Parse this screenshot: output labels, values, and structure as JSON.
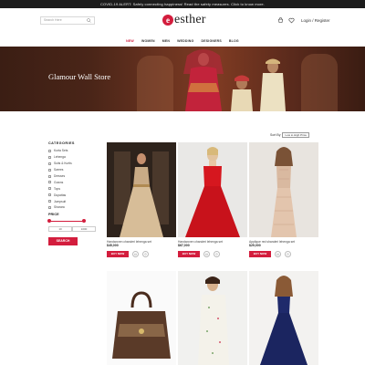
{
  "alert": "COVID-19 ALERT: Safely connecting happiness! Read the safety measures. Click to know more.",
  "search": {
    "placeholder": "Search Here"
  },
  "logo": {
    "mark": "e",
    "text": "esther"
  },
  "account": {
    "login": "Login",
    "separator": " / ",
    "register": "Register"
  },
  "nav": [
    "NEW",
    "WOMEN",
    "MEN",
    "WEDDING",
    "DESIGNERS",
    "BLOG"
  ],
  "banner": {
    "title": "Glamour Wall Store"
  },
  "sidebar": {
    "categories_heading": "CATEGORIES",
    "categories": [
      "Kurta Sets",
      "Lehenga",
      "Suits & Kurtis",
      "Sarees",
      "Dresses",
      "Gowns",
      "Tops",
      "Dupattas",
      "Jumpsuit",
      "Sharara"
    ],
    "price_heading": "PRICE",
    "price_min": "10",
    "price_max": "1000",
    "search_button": "SEARCH"
  },
  "sort": {
    "label": "Sort By",
    "selected": "Low to High Price"
  },
  "products": [
    {
      "name": "Handwoven chanderi lehenga set",
      "price": "$45,000",
      "buy": "BUY NOW"
    },
    {
      "name": "Handwoven chanderi lehenga set",
      "price": "$67,000",
      "buy": "BUY NOW"
    },
    {
      "name": "Applique red shanderi lehenga set",
      "price": "$29,000",
      "buy": "BUY NOW"
    }
  ],
  "colors": {
    "accent": "#d31d3d",
    "alert_bg": "#1c1c1c",
    "banner_bg": "#5a2a1c"
  }
}
